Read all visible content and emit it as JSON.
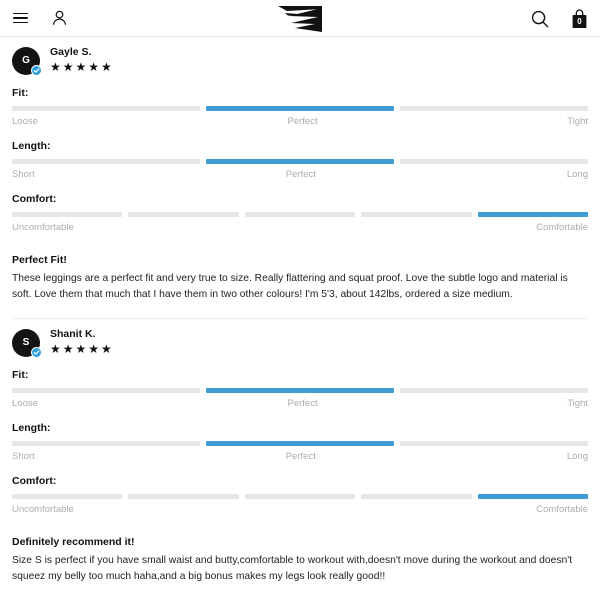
{
  "header": {
    "menu_label": "Menu",
    "account_label": "Account",
    "logo_label": "Gymshark",
    "search_label": "Search",
    "bag_label": "Bag",
    "bag_count": "0"
  },
  "accent_color": "#3f9bd4",
  "meters": {
    "fit": {
      "label": "Fit:",
      "scale": [
        "Loose",
        "Perfect",
        "Tight"
      ],
      "segments": 3,
      "selected": 2
    },
    "length": {
      "label": "Length:",
      "scale": [
        "Short",
        "Perfect",
        "Long"
      ],
      "segments": 3,
      "selected": 2
    },
    "comfort": {
      "label": "Comfort:",
      "scale": [
        "Uncomfortable",
        "",
        "Comfortable"
      ],
      "segments": 5,
      "selected": 5
    }
  },
  "reviews": [
    {
      "initial": "G",
      "name": "Gayle S.",
      "stars": "★★★★★",
      "rating": 5,
      "verified": true,
      "title": "Perfect Fit!",
      "text": "These leggings are a perfect fit and very true to size. Really flattering and squat proof. Love the subtle logo and material is soft. Love them that much that I have them in two other colours! I'm 5'3, about 142lbs, ordered a size medium."
    },
    {
      "initial": "S",
      "name": "Shanit K.",
      "stars": "★★★★★",
      "rating": 5,
      "verified": true,
      "title": "Definitely recommend it!",
      "text": "Size S is perfect if you have small waist and butty,comfortable to workout with,doesn't move during the workout and doesn't squeez my belly too much haha,and a big bonus makes my legs look really good!!"
    }
  ]
}
